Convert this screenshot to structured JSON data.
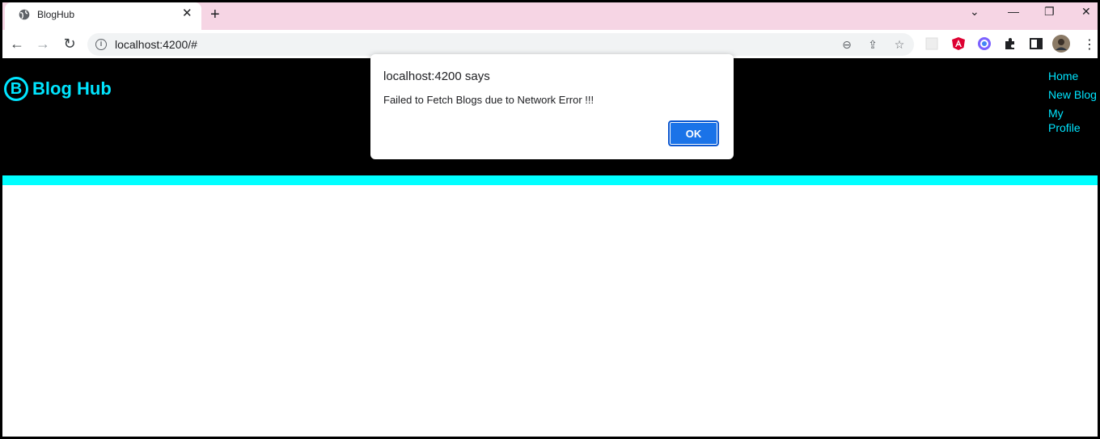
{
  "browser": {
    "tab_title": "BlogHub",
    "tab_close": "✕",
    "new_tab": "+",
    "url": "localhost:4200/#",
    "window_controls": {
      "dropdown": "⌄",
      "minimize": "—",
      "restore": "❐",
      "close": "✕"
    }
  },
  "app": {
    "brand_letter": "B",
    "brand_name": "Blog Hub",
    "accent_color": "#00e5ff",
    "nav": [
      {
        "label": "Home"
      },
      {
        "label": "New Blog"
      },
      {
        "label": "My Profile"
      }
    ]
  },
  "dialog": {
    "title": "localhost:4200 says",
    "message": "Failed to Fetch Blogs due to Network Error !!!",
    "ok_label": "OK"
  }
}
